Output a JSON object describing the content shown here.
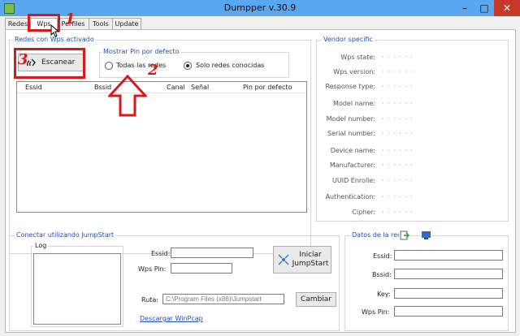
{
  "window": {
    "title": "Dumpper v.30.9",
    "min_label": "–",
    "max_label": "□",
    "close_label": "✕"
  },
  "tabs": [
    {
      "label": "Redes"
    },
    {
      "label": "Wps",
      "active": true
    },
    {
      "label": "Perfiles"
    },
    {
      "label": "Tools"
    },
    {
      "label": "Update"
    }
  ],
  "redes_wps": {
    "group_label": "Redes con Wps activado",
    "scan_button": "Escanear",
    "pin_group_label": "Mostrar Pin por defecto",
    "radio_all": "Todas las redes",
    "radio_known": "Solo redes conocidas",
    "radio_selected": "known",
    "columns": [
      "Essid",
      "Bssid",
      "Canal",
      "Señal",
      "Pin por defecto"
    ]
  },
  "vendor": {
    "group_label": "Vendor specific",
    "fields": [
      {
        "label": "Wps state:",
        "value": "· · · · · ·"
      },
      {
        "label": "Wps version:",
        "value": "· · · · · ·"
      },
      {
        "label": "Response type:",
        "value": "· · · · · ·"
      },
      {
        "label": "Model name:",
        "value": "· · · · · ·"
      },
      {
        "label": "Model number:",
        "value": "· · · · · ·"
      },
      {
        "label": "Serial number:",
        "value": "· · · · · ·"
      },
      {
        "label": "Device name:",
        "value": "· · · · · ·"
      },
      {
        "label": "Manufacturer:",
        "value": "· · · · · ·"
      },
      {
        "label": "UUID Enrolle:",
        "value": "· · · · · ·"
      },
      {
        "label": "Authentication:",
        "value": "· · · · · ·"
      },
      {
        "label": "Cipher:",
        "value": "· · · · · ·"
      }
    ]
  },
  "jumpstart": {
    "group_label": "Conectar utilizando JumpStart",
    "log_label": "Log",
    "essid_label": "Essid:",
    "essid_value": "",
    "wps_pin_label": "Wps Pin:",
    "wps_pin_value": "",
    "start_button_line1": "Iniciar",
    "start_button_line2": "JumpStart",
    "ruta_label": "Ruta:",
    "ruta_value": "C:\\Program Files (x86)\\Jumpstart",
    "cambiar_button": "Cambiar",
    "winpcap_link": "Descargar WinPcap"
  },
  "datos_red": {
    "group_label": "Datos de la red",
    "essid_label": "Essid:",
    "bssid_label": "Bssid:",
    "key_label": "Key:",
    "wps_pin_label": "Wps Pin:"
  },
  "annotations": {
    "step1": "1",
    "step2": "2",
    "step3": "3"
  },
  "colors": {
    "annotation": "#d91919",
    "title_bar": "#5aa7ef",
    "link": "#1f4fbf",
    "close": "#c7392b"
  }
}
